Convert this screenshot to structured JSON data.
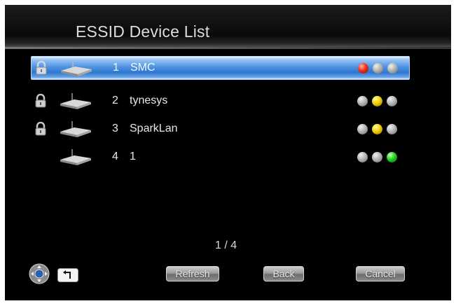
{
  "header": {
    "title": "ESSID Device List"
  },
  "devices": [
    {
      "index": "1",
      "ssid": "SMC",
      "locked": true,
      "selected": true,
      "signal": [
        "red",
        "gray",
        "gray"
      ]
    },
    {
      "index": "2",
      "ssid": "tynesys",
      "locked": true,
      "selected": false,
      "signal": [
        "gray",
        "yellow",
        "gray"
      ]
    },
    {
      "index": "3",
      "ssid": "SparkLan",
      "locked": true,
      "selected": false,
      "signal": [
        "gray",
        "yellow",
        "gray"
      ]
    },
    {
      "index": "4",
      "ssid": "1",
      "locked": false,
      "selected": false,
      "signal": [
        "gray",
        "gray",
        "green"
      ]
    }
  ],
  "pagination": {
    "label": "1 / 4"
  },
  "footer": {
    "nav_icon": "directional-pad-icon",
    "return_icon": "return-arrow-icon",
    "refresh_label": "Refresh",
    "back_label": "Back",
    "cancel_label": "Cancel"
  },
  "colors": {
    "selection": "#3b82d6",
    "background": "#000000",
    "text": "#e8e8e8"
  }
}
